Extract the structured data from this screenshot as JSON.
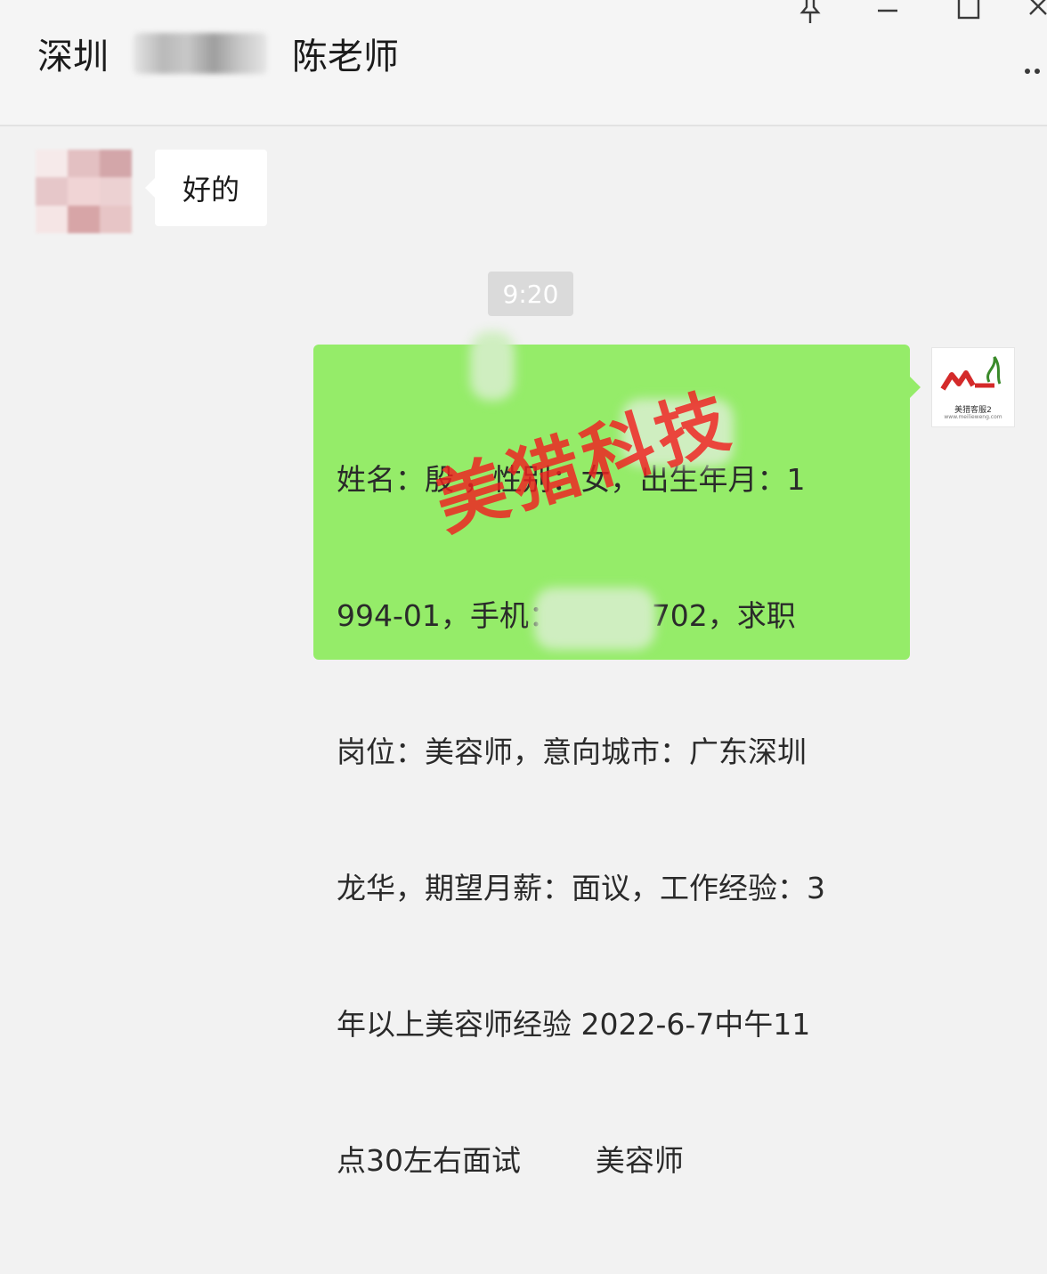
{
  "header": {
    "title_prefix": "深圳",
    "title_suffix": "陈老师",
    "controls": {
      "pin": "pin-icon",
      "minimize": "minimize-icon",
      "maximize": "maximize-icon",
      "close": "close-icon",
      "more": "more-icon"
    }
  },
  "messages": {
    "incoming": {
      "text": "好的"
    },
    "timestamp": "9:20",
    "outgoing": {
      "lines": [
        "姓名：殷 ，性别：女，出生年月：1",
        "994-01，手机：15      702，求职",
        "岗位：美容师，意向城市：广东深圳",
        "龙华，期望月薪：面议，工作经验：3",
        "年以上美容师经验 2022-6-7中午11",
        "点30左右面试        美容师"
      ]
    },
    "watermark": "美猎科技"
  },
  "avatars": {
    "sender_logo_caption": "美猎客服2",
    "sender_logo_sub": "www.meilieweng.com"
  },
  "colors": {
    "outgoing_bubble": "#95ec69",
    "incoming_bubble": "#ffffff",
    "watermark": "#f02020",
    "logo_red": "#d42a2a",
    "logo_green": "#3a8a2a"
  }
}
